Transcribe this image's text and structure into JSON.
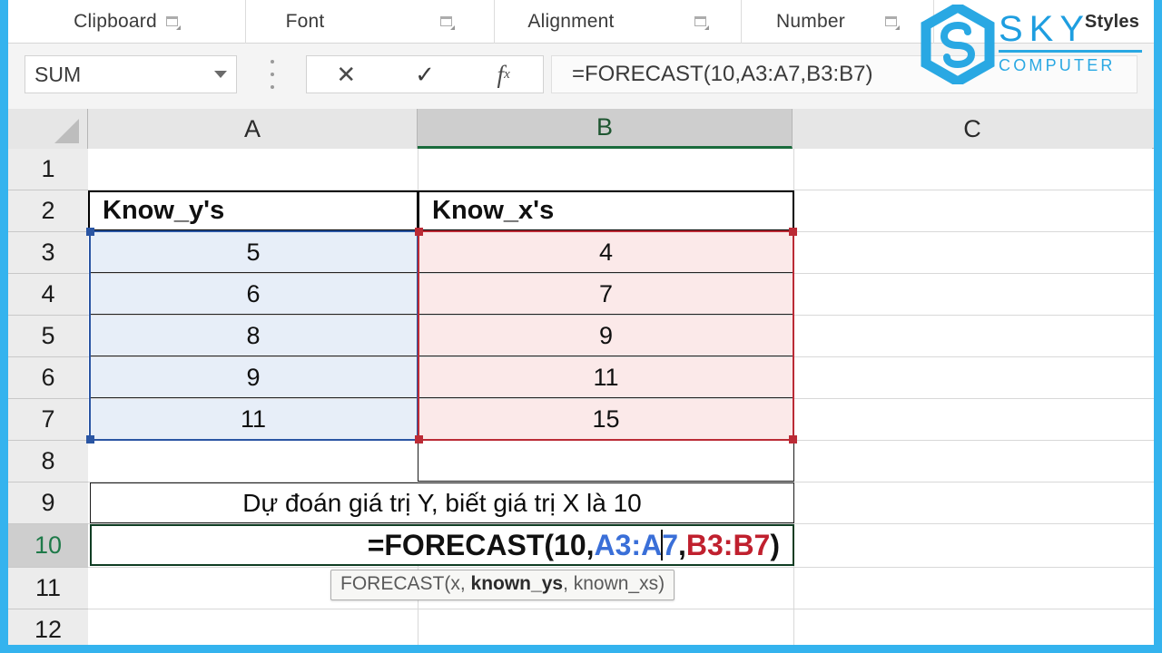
{
  "theme": {
    "frame_color": "#34b3ee",
    "blue_range": "#2a55a3",
    "red_range": "#bb2b36",
    "active_green": "#1a6b3c",
    "logo_blue": "#29a8e3"
  },
  "ribbon": {
    "groups": [
      {
        "label": "Clipboard",
        "launcher": true
      },
      {
        "label": "Font",
        "launcher": true
      },
      {
        "label": "Alignment",
        "launcher": true
      },
      {
        "label": "Number",
        "launcher": true
      },
      {
        "label": "Styles",
        "launcher": false
      }
    ]
  },
  "formula_bar": {
    "name_box_value": "SUM",
    "cancel_label": "✕",
    "enter_label": "✓",
    "fx_label": "fx",
    "content": "=FORECAST(10,A3:A7,B3:B7)"
  },
  "watermark": {
    "brand": "SKY",
    "sub": "COMPUTER"
  },
  "sheet": {
    "columns": [
      "A",
      "B",
      "C"
    ],
    "active_column": "B",
    "rows": [
      "1",
      "2",
      "3",
      "4",
      "5",
      "6",
      "7",
      "8",
      "9",
      "10",
      "11",
      "12"
    ],
    "active_row": "10",
    "headers": {
      "a2": "Know_y's",
      "b2": "Know_x's"
    },
    "known_ys": [
      "5",
      "6",
      "8",
      "9",
      "11"
    ],
    "known_xs": [
      "4",
      "7",
      "9",
      "11",
      "15"
    ],
    "note_row9": "Dự đoán giá trị Y, biết giá trị X là 10",
    "edit_cell": {
      "ref": "A10",
      "prefix": "=FORECAST(10,",
      "arg_y_a": "A3:A",
      "arg_y_b": "7",
      "comma": ",",
      "arg_x": "B3:B7",
      "suffix": ")"
    },
    "tooltip": {
      "pre": "FORECAST(x, ",
      "bold": "known_ys",
      "post": ", known_xs)"
    }
  },
  "chart_data": {
    "type": "table",
    "title": "FORECAST worksheet data",
    "columns": [
      "Know_y's",
      "Know_x's"
    ],
    "rows": [
      [
        5,
        4
      ],
      [
        6,
        7
      ],
      [
        8,
        9
      ],
      [
        9,
        11
      ],
      [
        11,
        15
      ]
    ],
    "annotation": "Predict Y when X = 10 using =FORECAST(10,A3:A7,B3:B7)"
  }
}
